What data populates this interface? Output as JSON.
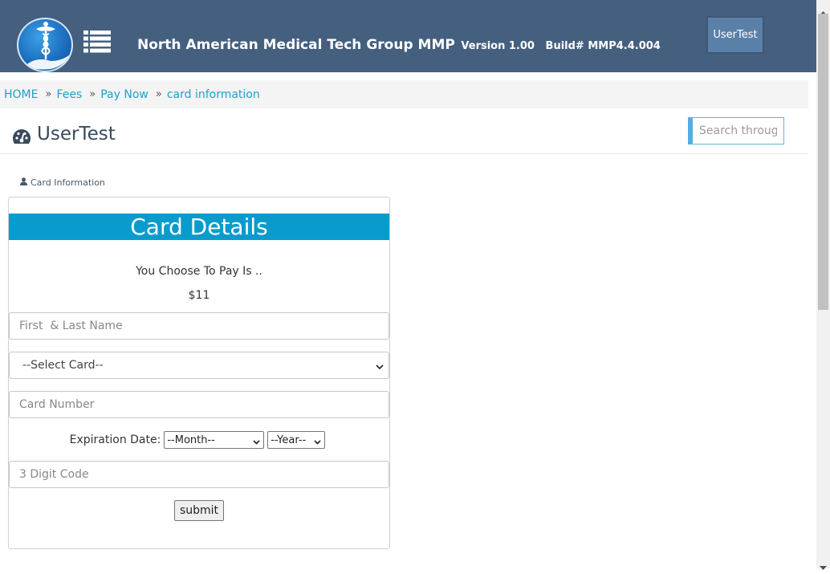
{
  "header": {
    "app_name": "North American Medical Tech Group MMP",
    "version": "Version 1.00",
    "build": "Build# MMP4.4.004",
    "user_button": "UserTest",
    "icons": {
      "logo": "caduceus-hand-logo",
      "menu": "list-menu-icon"
    }
  },
  "breadcrumb": {
    "items": [
      "HOME",
      "Fees",
      "Pay Now",
      "card information"
    ],
    "separator": "»"
  },
  "page": {
    "title": "UserTest",
    "title_icon": "dashboard-gauge-icon",
    "search_placeholder": "Search through..."
  },
  "section_label": {
    "text": "Card Information",
    "icon": "user-icon"
  },
  "card_form": {
    "heading": "Card Details",
    "choose_text": "You Choose To Pay Is ..",
    "amount": "$11",
    "name_placeholder": "First  & Last Name",
    "card_select": "--Select Card--",
    "card_number_placeholder": "Card Number",
    "expiration_label": "Expiration Date:",
    "month_select": "--Month--",
    "year_select": "--Year--",
    "cvv_placeholder": "3 Digit Code",
    "submit_label": "submit"
  },
  "colors": {
    "header_bg": "#45607f",
    "accent": "#0a9bcd",
    "link": "#1ba2c6",
    "breadcrumb_bg": "#f4f4f4"
  }
}
